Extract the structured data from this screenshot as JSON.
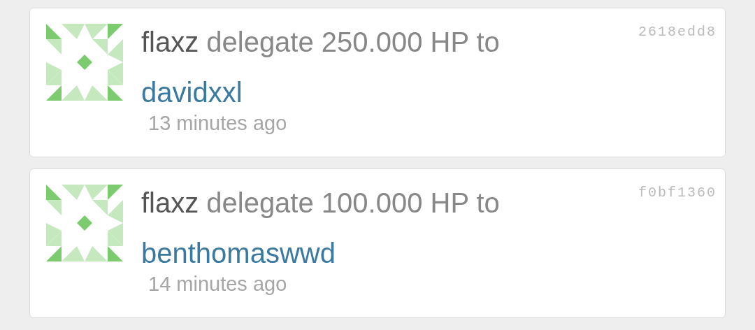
{
  "items": [
    {
      "author": "flaxz",
      "action": "delegate 250.000 HP to",
      "recipient": "davidxxl",
      "time": "13 minutes ago",
      "hash": "2618edd8"
    },
    {
      "author": "flaxz",
      "action": "delegate 100.000 HP to",
      "recipient": "benthomaswwd",
      "time": "14 minutes ago",
      "hash": "f0bf1360"
    }
  ]
}
